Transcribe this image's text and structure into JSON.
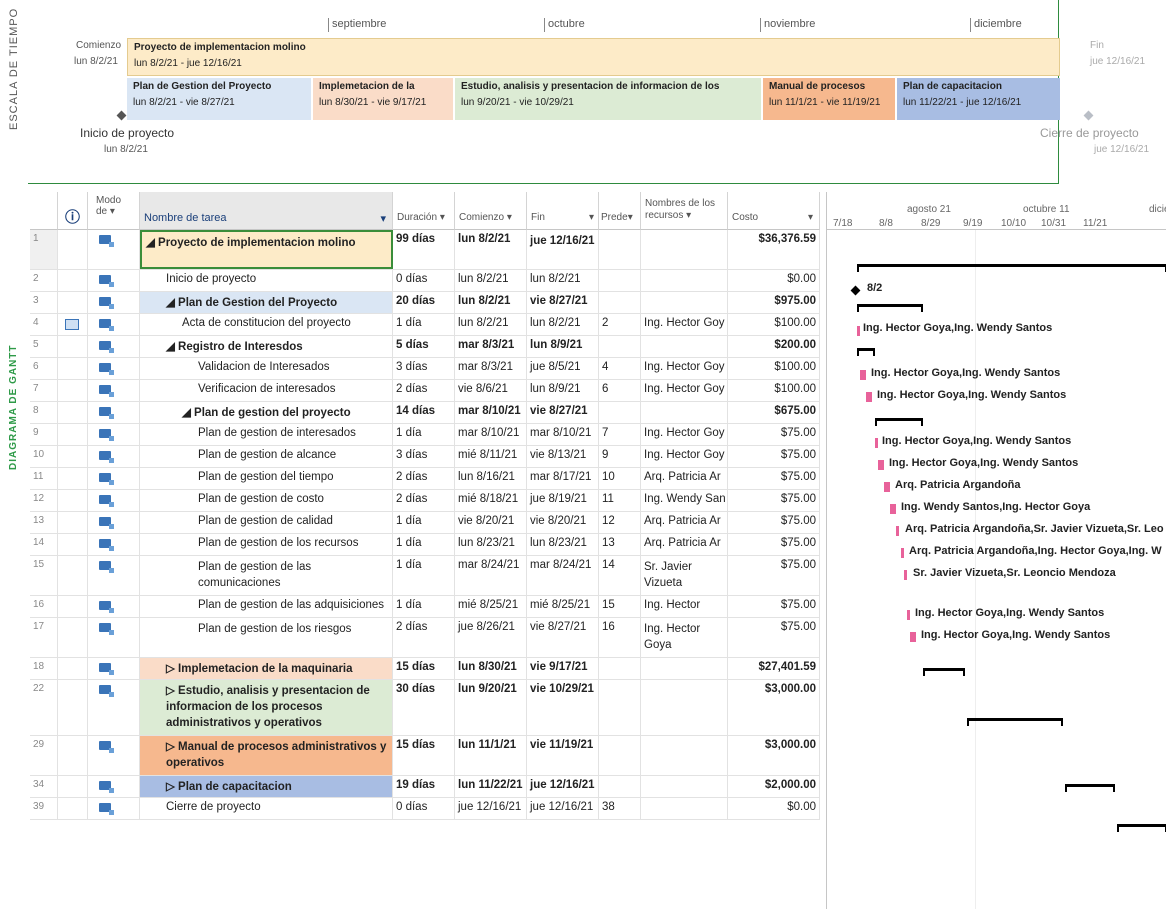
{
  "timeline": {
    "side_label": "ESCALA DE TIEMPO",
    "months": [
      "septiembre",
      "octubre",
      "noviembre",
      "diciembre"
    ],
    "start_label": "Comienzo",
    "start_date": "lun 8/2/21",
    "end_label": "Fin",
    "end_date": "jue 12/16/21",
    "project_bar": {
      "title": "Proyecto de implementacion molino",
      "dates": "lun 8/2/21 - jue 12/16/21"
    },
    "phases": [
      {
        "title": "Plan de Gestion del Proyecto",
        "dates": "lun 8/2/21 - vie 8/27/21",
        "color": "#dae6f4"
      },
      {
        "title": "Implemetacion de la",
        "dates": "lun 8/30/21 - vie 9/17/21",
        "color": "#fadcc8"
      },
      {
        "title": "Estudio, analisis y presentacion de informacion de los",
        "dates": "lun 9/20/21 - vie 10/29/21",
        "color": "#dcebd4"
      },
      {
        "title": "Manual de procesos",
        "dates": "lun 11/1/21 - vie 11/19/21",
        "color": "#f6b88e"
      },
      {
        "title": "Plan de capacitacion",
        "dates": "lun 11/22/21 - jue 12/16/21",
        "color": "#a8bde3"
      }
    ],
    "milestone_start": {
      "title": "Inicio de proyecto",
      "date": "lun 8/2/21"
    },
    "milestone_end": {
      "title": "Cierre de proyecto",
      "date": "jue 12/16/21"
    }
  },
  "gantt_side_label": "DIAGRAMA DE GANTT",
  "columns": {
    "info": "ⓘ",
    "mode": "Modo de",
    "name": "Nombre de tarea",
    "duration": "Duración",
    "start": "Comienzo",
    "finish": "Fin",
    "pred": "Prede",
    "resources": "Nombres de los recursos",
    "cost": "Costo"
  },
  "rows": [
    {
      "id": "1",
      "name": "◢ Proyecto de implementacion molino",
      "duration": "99 días",
      "start": "lun 8/2/21",
      "finish": "jue 12/16/21",
      "pred": "",
      "res": "",
      "cost": "$36,376.59"
    },
    {
      "id": "2",
      "name": "Inicio de proyecto",
      "duration": "0 días",
      "start": "lun 8/2/21",
      "finish": "lun 8/2/21",
      "pred": "",
      "res": "",
      "cost": "$0.00"
    },
    {
      "id": "3",
      "name": "◢ Plan de Gestion del Proyecto",
      "duration": "20 días",
      "start": "lun 8/2/21",
      "finish": "vie 8/27/21",
      "pred": "",
      "res": "",
      "cost": "$975.00"
    },
    {
      "id": "4",
      "name": "Acta de constitucion del proyecto",
      "duration": "1 día",
      "start": "lun 8/2/21",
      "finish": "lun 8/2/21",
      "pred": "2",
      "res": "Ing. Hector Goy",
      "cost": "$100.00"
    },
    {
      "id": "5",
      "name": "◢ Registro de Interesdos",
      "duration": "5 días",
      "start": "mar 8/3/21",
      "finish": "lun 8/9/21",
      "pred": "",
      "res": "",
      "cost": "$200.00"
    },
    {
      "id": "6",
      "name": "Validacion de Interesados",
      "duration": "3 días",
      "start": "mar 8/3/21",
      "finish": "jue 8/5/21",
      "pred": "4",
      "res": "Ing. Hector Goy",
      "cost": "$100.00"
    },
    {
      "id": "7",
      "name": "Verificacion de interesados",
      "duration": "2 días",
      "start": "vie 8/6/21",
      "finish": "lun 8/9/21",
      "pred": "6",
      "res": "Ing. Hector Goy",
      "cost": "$100.00"
    },
    {
      "id": "8",
      "name": "◢ Plan de gestion del proyecto",
      "duration": "14 días",
      "start": "mar 8/10/21",
      "finish": "vie 8/27/21",
      "pred": "",
      "res": "",
      "cost": "$675.00"
    },
    {
      "id": "9",
      "name": "Plan de gestion de interesados",
      "duration": "1 día",
      "start": "mar 8/10/21",
      "finish": "mar 8/10/21",
      "pred": "7",
      "res": "Ing. Hector Goy",
      "cost": "$75.00"
    },
    {
      "id": "10",
      "name": "Plan de gestion de alcance",
      "duration": "3 días",
      "start": "mié 8/11/21",
      "finish": "vie 8/13/21",
      "pred": "9",
      "res": "Ing. Hector Goy",
      "cost": "$75.00"
    },
    {
      "id": "11",
      "name": "Plan de gestion del tiempo",
      "duration": "2 días",
      "start": "lun 8/16/21",
      "finish": "mar 8/17/21",
      "pred": "10",
      "res": "Arq. Patricia Ar",
      "cost": "$75.00"
    },
    {
      "id": "12",
      "name": "Plan de gestion de costo",
      "duration": "2 días",
      "start": "mié 8/18/21",
      "finish": "jue 8/19/21",
      "pred": "11",
      "res": "Ing. Wendy San",
      "cost": "$75.00"
    },
    {
      "id": "13",
      "name": "Plan de gestion de calidad",
      "duration": "1 día",
      "start": "vie 8/20/21",
      "finish": "vie 8/20/21",
      "pred": "12",
      "res": "Arq. Patricia Ar",
      "cost": "$75.00"
    },
    {
      "id": "14",
      "name": "Plan de gestion de los recursos",
      "duration": "1 día",
      "start": "lun 8/23/21",
      "finish": "lun 8/23/21",
      "pred": "13",
      "res": "Arq. Patricia Ar",
      "cost": "$75.00"
    },
    {
      "id": "15",
      "name": "Plan de gestion de las comunicaciones",
      "duration": "1 día",
      "start": "mar 8/24/21",
      "finish": "mar 8/24/21",
      "pred": "14",
      "res": "Sr. Javier Vizueta",
      "cost": "$75.00"
    },
    {
      "id": "16",
      "name": "Plan de gestion de las adquisiciones",
      "duration": "1 día",
      "start": "mié 8/25/21",
      "finish": "mié 8/25/21",
      "pred": "15",
      "res": "Ing. Hector",
      "cost": "$75.00"
    },
    {
      "id": "17",
      "name": "Plan de gestion de los riesgos",
      "duration": "2 días",
      "start": "jue 8/26/21",
      "finish": "vie 8/27/21",
      "pred": "16",
      "res": "Ing. Hector Goya",
      "cost": "$75.00"
    },
    {
      "id": "18",
      "name": "▷ Implemetacion de la maquinaria",
      "duration": "15 días",
      "start": "lun 8/30/21",
      "finish": "vie 9/17/21",
      "pred": "",
      "res": "",
      "cost": "$27,401.59"
    },
    {
      "id": "22",
      "name": "▷ Estudio, analisis y presentacion de informacion de los procesos administrativos y operativos",
      "duration": "30 días",
      "start": "lun 9/20/21",
      "finish": "vie 10/29/21",
      "pred": "",
      "res": "",
      "cost": "$3,000.00"
    },
    {
      "id": "29",
      "name": "▷ Manual de procesos administrativos y operativos",
      "duration": "15 días",
      "start": "lun 11/1/21",
      "finish": "vie 11/19/21",
      "pred": "",
      "res": "",
      "cost": "$3,000.00"
    },
    {
      "id": "34",
      "name": "▷ Plan de capacitacion",
      "duration": "19 días",
      "start": "lun 11/22/21",
      "finish": "jue 12/16/21",
      "pred": "",
      "res": "",
      "cost": "$2,000.00"
    },
    {
      "id": "39",
      "name": "Cierre de proyecto",
      "duration": "0 días",
      "start": "jue 12/16/21",
      "finish": "jue 12/16/21",
      "pred": "38",
      "res": "",
      "cost": "$0.00"
    }
  ],
  "gantt": {
    "top_scale": [
      "agosto 21",
      "octubre 11",
      "dicie"
    ],
    "bottom_scale": [
      "7/18",
      "8/8",
      "8/29",
      "9/19",
      "10/10",
      "10/31",
      "11/21"
    ],
    "milestone_label": "8/2",
    "labels": [
      "Ing. Hector Goya,Ing. Wendy Santos",
      "Ing. Hector Goya,Ing. Wendy Santos",
      "Ing. Hector Goya,Ing. Wendy Santos",
      "Ing. Hector Goya,Ing. Wendy Santos",
      "Ing. Hector Goya,Ing. Wendy Santos",
      "Arq. Patricia Argandoña",
      "Ing. Wendy Santos,Ing. Hector Goya",
      "Arq. Patricia Argandoña,Sr. Javier Vizueta,Sr. Leo",
      "Arq. Patricia Argandoña,Ing. Hector Goya,Ing. W",
      "Sr. Javier Vizueta,Sr. Leoncio Mendoza",
      "Ing. Hector Goya,Ing. Wendy Santos",
      "Ing. Hector Goya,Ing. Wendy Santos"
    ]
  }
}
